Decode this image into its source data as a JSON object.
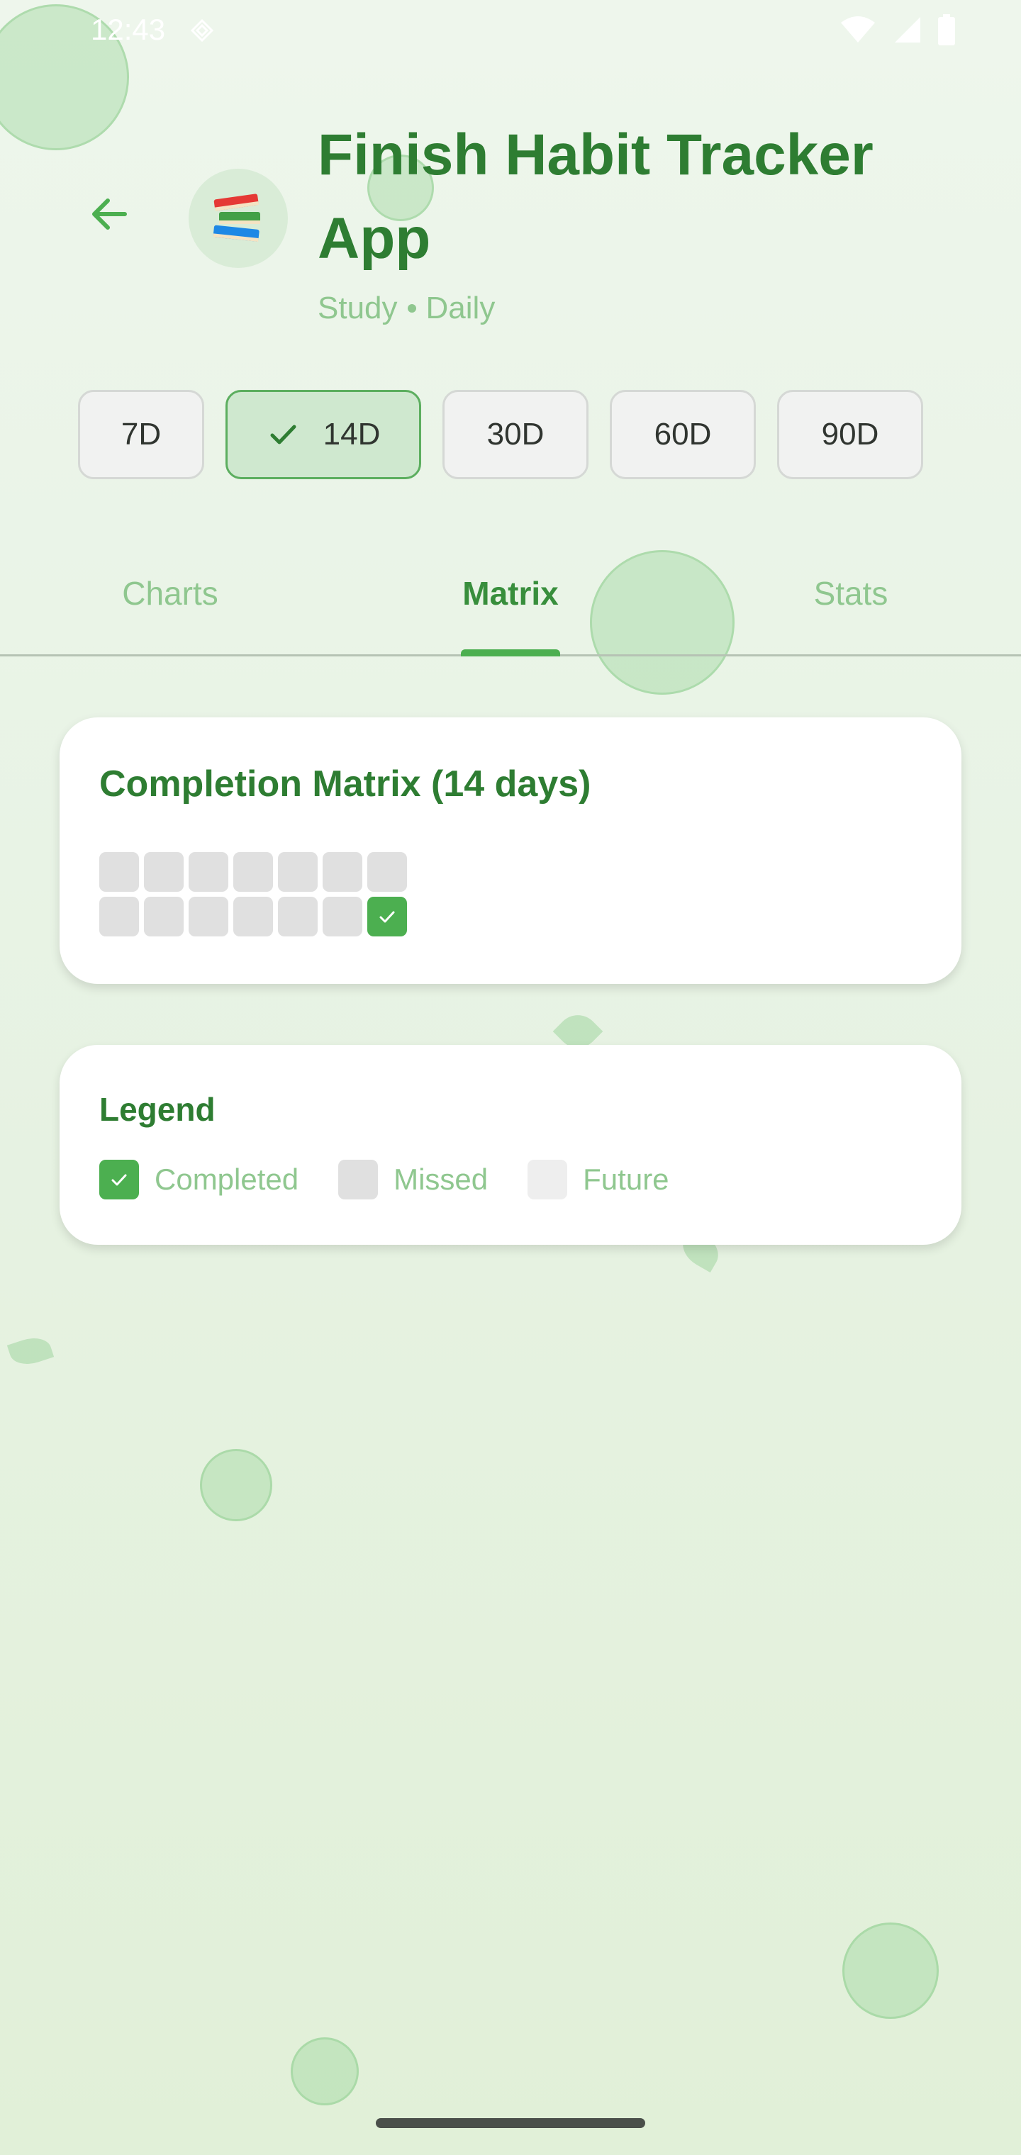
{
  "status_bar": {
    "time": "12:43",
    "icons": [
      "wifi-icon",
      "signal-icon",
      "battery-icon"
    ]
  },
  "header": {
    "back_icon": "arrow-left-icon",
    "habit_icon": "books-emoji",
    "habit_emoji": "📚",
    "title": "Finish Habit Tracker App",
    "category": "Study",
    "frequency": "Daily"
  },
  "range_chips": [
    {
      "label": "7D",
      "selected": false
    },
    {
      "label": "14D",
      "selected": true
    },
    {
      "label": "30D",
      "selected": false
    },
    {
      "label": "60D",
      "selected": false
    },
    {
      "label": "90D",
      "selected": false
    }
  ],
  "tabs": [
    {
      "label": "Charts",
      "active": false
    },
    {
      "label": "Matrix",
      "active": true
    },
    {
      "label": "Stats",
      "active": false
    }
  ],
  "matrix": {
    "title": "Completion Matrix (14 days)",
    "days": [
      "missed",
      "missed",
      "missed",
      "missed",
      "missed",
      "missed",
      "missed",
      "missed",
      "missed",
      "missed",
      "missed",
      "missed",
      "missed",
      "completed"
    ]
  },
  "legend": {
    "title": "Legend",
    "items": [
      {
        "label": "Completed",
        "state": "completed"
      },
      {
        "label": "Missed",
        "state": "missed"
      },
      {
        "label": "Future",
        "state": "future"
      }
    ]
  },
  "colors": {
    "primary": "#2e7d32",
    "accent": "#4caf50",
    "muted_text": "#8fc78f",
    "missed_cell": "#e0e0e0",
    "future_cell": "#eeeeee",
    "chip_selected_bg": "#cfe8cf"
  }
}
